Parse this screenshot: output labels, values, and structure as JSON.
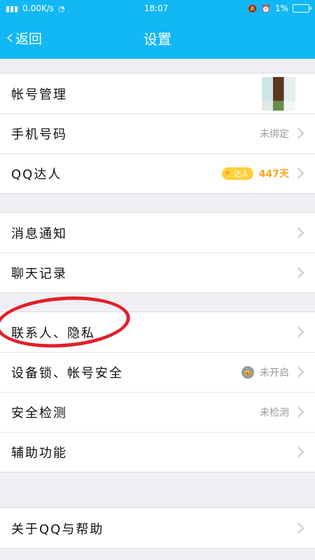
{
  "status_bar": {
    "network_speed": "0.00K/s",
    "time": "18:07",
    "battery": "1%"
  },
  "nav": {
    "back_label": "返回",
    "title": "设置"
  },
  "groups": [
    [
      {
        "label": "帐号管理",
        "kind": "avatar"
      },
      {
        "label": "手机号码",
        "value": "未绑定"
      },
      {
        "label": "QQ达人",
        "badge": "达人",
        "value": "447天",
        "value_color": "#f5a623"
      }
    ],
    [
      {
        "label": "消息通知"
      },
      {
        "label": "聊天记录"
      }
    ],
    [
      {
        "label": "联系人、隐私"
      },
      {
        "label": "设备锁、帐号安全",
        "value": "未开启",
        "icon": "lock-icon"
      },
      {
        "label": "安全检测",
        "value": "未检测"
      },
      {
        "label": "辅助功能"
      }
    ],
    [
      {
        "label": "关于QQ与帮助"
      }
    ]
  ],
  "colors": {
    "accent": "#12b7f5",
    "annotation": "#e0202a"
  }
}
